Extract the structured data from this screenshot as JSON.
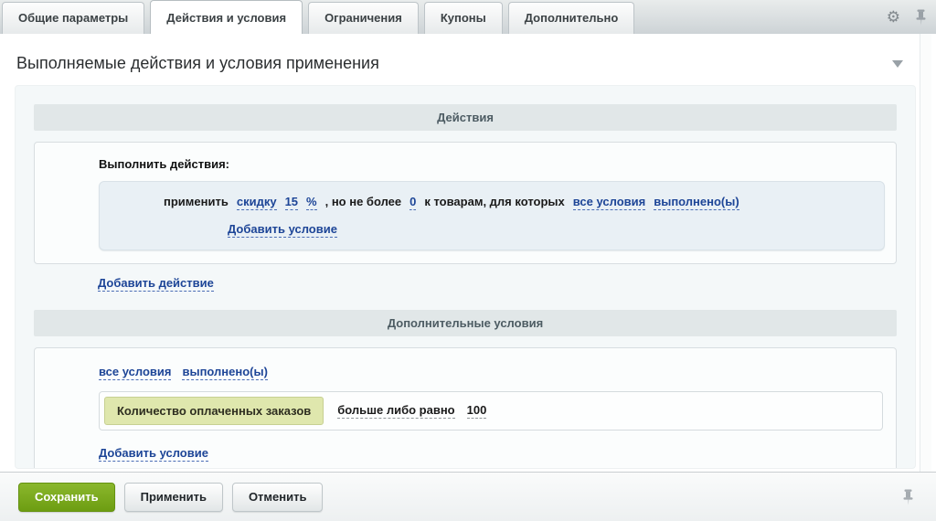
{
  "tabs": [
    {
      "label": "Общие параметры",
      "active": false
    },
    {
      "label": "Действия и условия",
      "active": true
    },
    {
      "label": "Ограничения",
      "active": false
    },
    {
      "label": "Купоны",
      "active": false
    },
    {
      "label": "Дополнительно",
      "active": false
    }
  ],
  "header": {
    "title": "Выполняемые действия и условия применения"
  },
  "actions_section": {
    "bar_title": "Действия",
    "label": "Выполнить действия:",
    "rule": {
      "apply_text": "применить",
      "discount_link": "скидку",
      "value_link": "15",
      "unit_link": "%",
      "not_more_text": ", но не более",
      "max_value_link": "0",
      "to_products_text": "к товарам, для которых",
      "all_conditions_link": "все условия",
      "fulfilled_link": "выполнено(ы)",
      "add_condition_link": "Добавить условие"
    },
    "add_action_link": "Добавить действие"
  },
  "extra_conditions_section": {
    "bar_title": "Дополнительные условия",
    "all_conditions_link": "все условия",
    "fulfilled_link": "выполнено(ы)",
    "condition": {
      "field_chip": "Количество оплаченных заказов",
      "operator_link": "больше либо равно",
      "value_link": "100"
    },
    "add_condition_link": "Добавить условие"
  },
  "footer": {
    "save_label": "Сохранить",
    "apply_label": "Применить",
    "cancel_label": "Отменить"
  },
  "icons": {
    "settings": "gear-icon",
    "pin_top": "pin-icon",
    "pin_bottom": "pin-icon",
    "collapse": "chevron-down-icon"
  },
  "colors": {
    "link_blue": "#1d4597",
    "accent_green": "#7aa71d",
    "chip_bg": "#dfe7ad",
    "panel_bg": "#f4f8f9",
    "section_bar_bg": "#e1e7e8",
    "rule_box_bg": "#e9f0f5"
  }
}
